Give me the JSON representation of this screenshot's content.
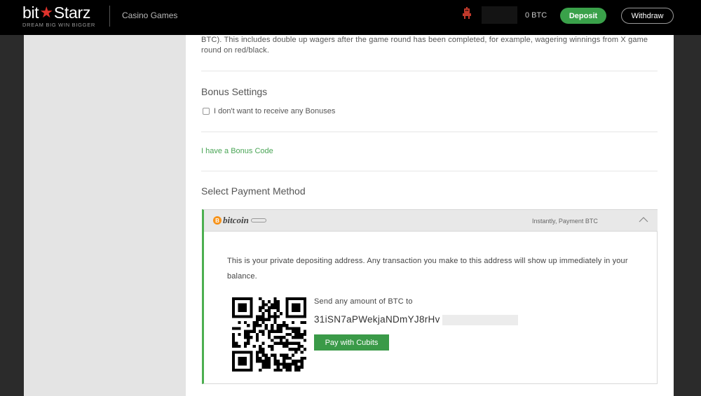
{
  "header": {
    "logo": {
      "word_left": "bit",
      "word_right": "Starz",
      "tagline": "DREAM BIG  WIN BIGGER"
    },
    "nav": {
      "casino_games": "Casino Games"
    },
    "balance": "0 BTC",
    "deposit_label": "Deposit",
    "withdraw_label": "Withdraw",
    "icons": {
      "robot": "robot-icon"
    },
    "colors": {
      "background": "#000000",
      "deposit": "#3aa14a",
      "logo_star": "#e0332c"
    }
  },
  "content": {
    "intro_text": "BTC). This includes double up wagers after the game round has been completed, for example, wagering winnings from X game round on red/black.",
    "bonus_settings": {
      "title": "Bonus Settings",
      "checkbox_label": "I don't want to receive any Bonuses",
      "checked": false
    },
    "bonus_code_link": "I have a Bonus Code",
    "payment": {
      "title": "Select Payment Method",
      "method": {
        "logo_text": "bitcoin",
        "logo_glyph": "B",
        "info": "Instantly, Payment BTC",
        "expanded": true,
        "private_text": "This is your private depositing address. Any transaction you make to this address will show up immediately in your balance.",
        "send_label": "Send any amount of BTC to",
        "address": "31iSN7aPWekjaNDmYJ8rHv",
        "pay_button": "Pay with Cubits"
      },
      "colors": {
        "accent": "#4caf50",
        "button": "#3a9a48",
        "link": "#4aa556"
      }
    }
  }
}
